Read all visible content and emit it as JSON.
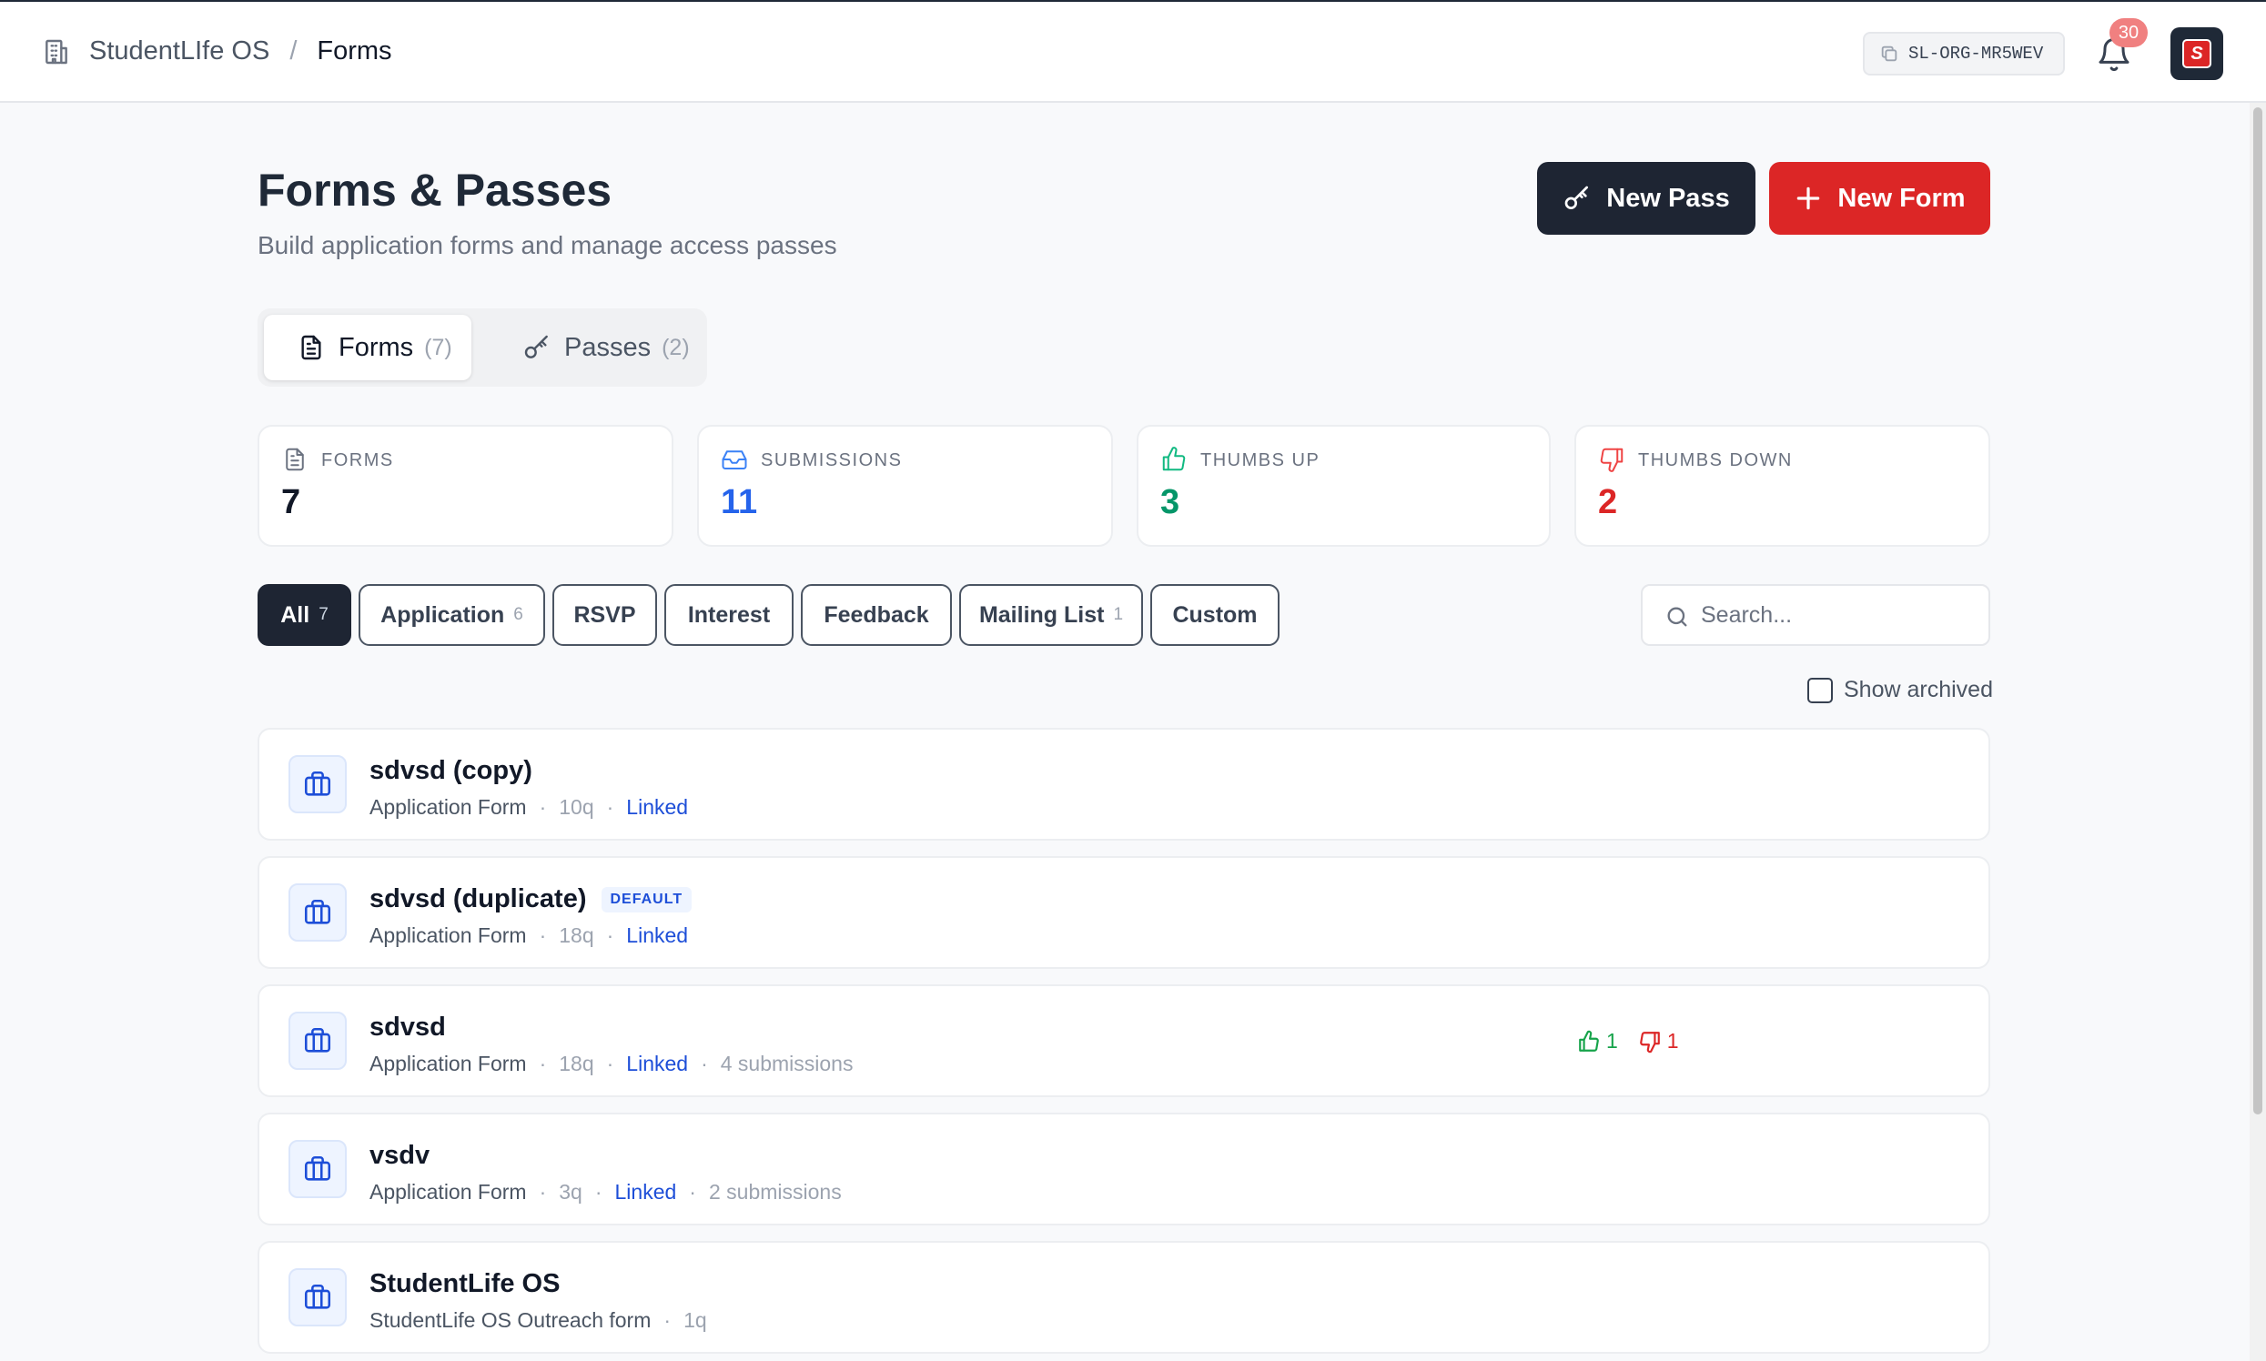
{
  "header": {
    "org_name": "StudentLIfe OS",
    "separator": "/",
    "current_page": "Forms",
    "org_code": "SL-ORG-MR5WEV",
    "notification_count": "30"
  },
  "page": {
    "title": "Forms & Passes",
    "subtitle": "Build application forms and manage access passes",
    "new_pass_label": "New Pass",
    "new_form_label": "New Form"
  },
  "tabs": [
    {
      "label": "Forms",
      "count": "(7)",
      "active": true
    },
    {
      "label": "Passes",
      "count": "(2)",
      "active": false
    }
  ],
  "stats": [
    {
      "label": "FORMS",
      "value": "7",
      "color": "#111827"
    },
    {
      "label": "SUBMISSIONS",
      "value": "11",
      "color": "#2563eb"
    },
    {
      "label": "THUMBS UP",
      "value": "3",
      "color": "#059669"
    },
    {
      "label": "THUMBS DOWN",
      "value": "2",
      "color": "#dc2626"
    }
  ],
  "filters": [
    {
      "label": "All",
      "count": "7"
    },
    {
      "label": "Application",
      "count": "6"
    },
    {
      "label": "RSVP",
      "count": ""
    },
    {
      "label": "Interest",
      "count": ""
    },
    {
      "label": "Feedback",
      "count": ""
    },
    {
      "label": "Mailing List",
      "count": "1"
    },
    {
      "label": "Custom",
      "count": ""
    }
  ],
  "search": {
    "placeholder": "Search..."
  },
  "show_archived_label": "Show archived",
  "forms": [
    {
      "name": "sdvsd (copy)",
      "badge": "",
      "type": "Application Form",
      "questions": "10q",
      "linked": "Linked",
      "submissions": ""
    },
    {
      "name": "sdvsd (duplicate)",
      "badge": "DEFAULT",
      "type": "Application Form",
      "questions": "18q",
      "linked": "Linked",
      "submissions": ""
    },
    {
      "name": "sdvsd",
      "badge": "",
      "type": "Application Form",
      "questions": "18q",
      "linked": "Linked",
      "submissions": "4 submissions",
      "thumbs_up": "1",
      "thumbs_down": "1"
    },
    {
      "name": "vsdv",
      "badge": "",
      "type": "Application Form",
      "questions": "3q",
      "linked": "Linked",
      "submissions": "2 submissions"
    },
    {
      "name": "StudentLife OS",
      "badge": "",
      "type": "StudentLife OS Outreach form",
      "questions": "1q",
      "linked": "",
      "submissions": ""
    }
  ],
  "colors": {
    "primary_dark": "#1e2533",
    "accent_red": "#dc2626",
    "link_blue": "#1d4ed8"
  }
}
